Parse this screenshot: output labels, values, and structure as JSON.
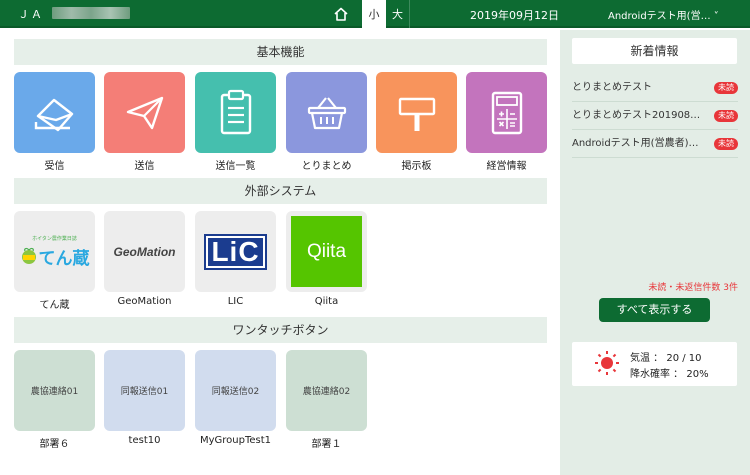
{
  "header": {
    "title": "ＪＡ",
    "size_small": "小",
    "size_large": "大",
    "date": "2019年09月12日",
    "user": "Androidテスト用(営…  ˅"
  },
  "sections": {
    "basic": "基本機能",
    "external": "外部システム",
    "onetouch": "ワンタッチボタン"
  },
  "basic_tiles": [
    {
      "label": "受信",
      "color": "#6aa9ea",
      "icon": "receive-envelope-icon"
    },
    {
      "label": "送信",
      "color": "#f47e77",
      "icon": "paper-plane-icon"
    },
    {
      "label": "送信一覧",
      "color": "#45bfae",
      "icon": "clipboard-icon"
    },
    {
      "label": "とりまとめ",
      "color": "#8b97dd",
      "icon": "basket-icon"
    },
    {
      "label": "掲示板",
      "color": "#f8945c",
      "icon": "signboard-icon"
    },
    {
      "label": "経営情報",
      "color": "#c374bd",
      "icon": "calculator-icon"
    }
  ],
  "external_tiles": [
    {
      "label": "てん蔵",
      "logo_text": "てん蔵",
      "logo_sub": "ホイタン農作業日誌"
    },
    {
      "label": "GeoMation",
      "logo_text": "GeoMation"
    },
    {
      "label": "LIC",
      "logo_text": "LiC"
    },
    {
      "label": "Qiita",
      "logo_text": "Qiita"
    }
  ],
  "onetouch_tiles": [
    {
      "label": "部署６",
      "text": "農協連絡01",
      "color": "#cddfd3"
    },
    {
      "label": "test10",
      "text": "同報送信01",
      "color": "#d1dcee"
    },
    {
      "label": "MyGroupTest1",
      "text": "同報送信02",
      "color": "#d1dcee"
    },
    {
      "label": "部署１",
      "text": "農協連絡02",
      "color": "#cddfd3"
    }
  ],
  "news": {
    "title": "新着情報",
    "items": [
      {
        "text": "とりまとめテスト",
        "badge": "未読"
      },
      {
        "text": "とりまとめテスト201908…",
        "badge": "未読"
      },
      {
        "text": "Androidテスト用(営農者)…",
        "badge": "未読"
      }
    ],
    "unread_count": "未読・未返信件数 3件",
    "show_all": "すべて表示する"
  },
  "weather": {
    "temp": "気温 ： 20 / 10",
    "rain": "降水確率 ： 20%",
    "icon": "sun-icon"
  },
  "colors": {
    "header": "#0d6b32",
    "badge": "#e8363a",
    "side_bg": "#e3ede6"
  }
}
